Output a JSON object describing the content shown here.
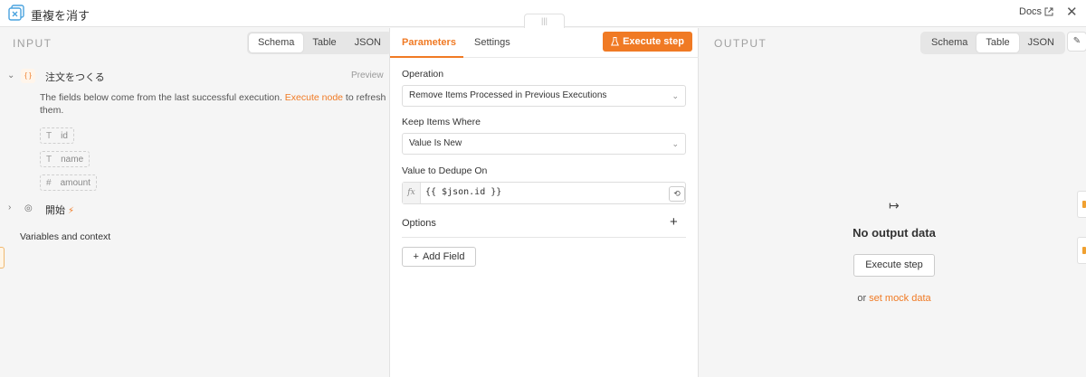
{
  "header": {
    "node_title": "重複を消す",
    "docs_label": "Docs",
    "drag_handle": "|||"
  },
  "input": {
    "label": "INPUT",
    "views": [
      "Schema",
      "Table",
      "JSON"
    ],
    "active_view": "Schema",
    "tree": {
      "node1": {
        "name": "注文をつくる",
        "preview": "Preview",
        "hint_before": "The fields below come from the last successful execution. ",
        "hint_link": "Execute node",
        "hint_after": " to refresh them.",
        "fields": [
          {
            "type": "T",
            "name": "id"
          },
          {
            "type": "T",
            "name": "name"
          },
          {
            "type": "#",
            "name": "amount"
          }
        ]
      },
      "node2": {
        "name": "開始"
      },
      "vars": "Variables and context"
    }
  },
  "params": {
    "tabs": [
      "Parameters",
      "Settings"
    ],
    "active_tab": "Parameters",
    "execute_label": "Execute step",
    "operation": {
      "label": "Operation",
      "value": "Remove Items Processed in Previous Executions"
    },
    "keep_items": {
      "label": "Keep Items Where",
      "value": "Value Is New"
    },
    "dedupe": {
      "label": "Value to Dedupe On",
      "fx": "fx",
      "value": "{{ $json.id }}"
    },
    "options_label": "Options",
    "add_field_label": "Add Field"
  },
  "output": {
    "label": "OUTPUT",
    "views": [
      "Schema",
      "Table",
      "JSON"
    ],
    "active_view": "Table",
    "empty_title": "No output data",
    "execute_label": "Execute step",
    "mock_prefix": "or ",
    "mock_link": "set mock data"
  },
  "colors": {
    "accent": "#f07a24"
  }
}
